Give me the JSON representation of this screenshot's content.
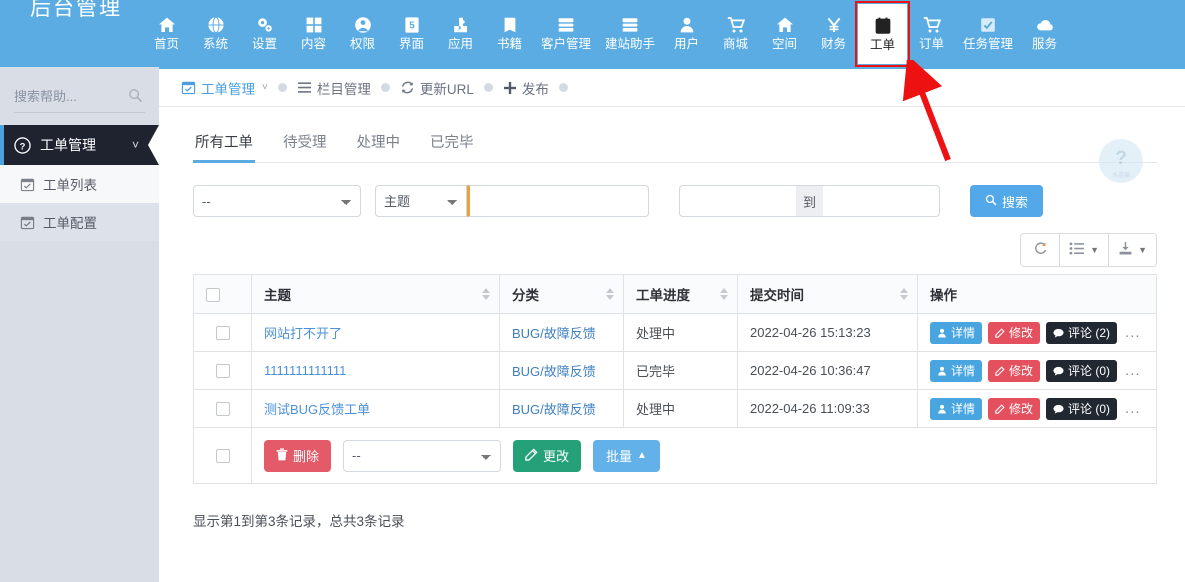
{
  "topnav": {
    "brand": "后台管理",
    "items": [
      {
        "label": "首页",
        "icon": "home-icon"
      },
      {
        "label": "系统",
        "icon": "globe-icon"
      },
      {
        "label": "设置",
        "icon": "gears-icon"
      },
      {
        "label": "内容",
        "icon": "grid-icon"
      },
      {
        "label": "权限",
        "icon": "user-circle-icon"
      },
      {
        "label": "界面",
        "icon": "layout-icon"
      },
      {
        "label": "应用",
        "icon": "puzzle-icon"
      },
      {
        "label": "书籍",
        "icon": "book-icon"
      },
      {
        "label": "客户管理",
        "icon": "server-icon"
      },
      {
        "label": "建站助手",
        "icon": "server-icon"
      },
      {
        "label": "用户",
        "icon": "user-icon"
      },
      {
        "label": "商城",
        "icon": "cart-icon"
      },
      {
        "label": "空间",
        "icon": "home-icon"
      },
      {
        "label": "财务",
        "icon": "yen-icon"
      },
      {
        "label": "工单",
        "icon": "clipboard-check-icon",
        "active": true
      },
      {
        "label": "订单",
        "icon": "cart-icon"
      },
      {
        "label": "任务管理",
        "icon": "check-square-icon"
      },
      {
        "label": "服务",
        "icon": "cloud-icon"
      }
    ]
  },
  "sidebar": {
    "search_placeholder": "搜索帮助...",
    "group": {
      "label": "工单管理",
      "icon": "question-circle-icon",
      "caret": "chevron-down-icon"
    },
    "links": [
      {
        "label": "工单列表",
        "icon": "calendar-check-icon"
      },
      {
        "label": "工单配置",
        "icon": "calendar-check-icon"
      }
    ]
  },
  "breadcrumb": [
    {
      "label": "工单管理",
      "icon": "calendar-check-icon",
      "primary": true,
      "caret": true
    },
    {
      "label": "栏目管理",
      "icon": "list-icon"
    },
    {
      "label": "更新URL",
      "icon": "refresh-icon"
    },
    {
      "label": "发布",
      "icon": "plus-icon"
    }
  ],
  "help_badge": {
    "symbol": "?",
    "caption": "水晶猫"
  },
  "tabs": [
    {
      "label": "所有工单",
      "active": true
    },
    {
      "label": "待受理",
      "active": false
    },
    {
      "label": "处理中",
      "active": false
    },
    {
      "label": "已完毕",
      "active": false
    }
  ],
  "filters": {
    "category_select": "--",
    "field_select": "主题",
    "keyword_value": "",
    "date_from": "",
    "date_to": "",
    "date_separator": "到",
    "search_button": "搜索",
    "search_icon": "search-icon"
  },
  "table_toolbar": [
    {
      "icon": "refresh-icon",
      "caret": false
    },
    {
      "icon": "columns-icon",
      "caret": true
    },
    {
      "icon": "export-icon",
      "caret": true
    }
  ],
  "table": {
    "headers": [
      "主题",
      "分类",
      "工单进度",
      "提交时间",
      "操作"
    ],
    "rows": [
      {
        "subject": "网站打不开了",
        "category": "BUG/故障反馈",
        "progress": "处理中",
        "submit_time": "2022-04-26 15:13:23",
        "actions": {
          "detail": "详情",
          "edit": "修改",
          "comment": "评论 (2)",
          "more": "..."
        }
      },
      {
        "subject": "1111111111111",
        "category": "BUG/故障反馈",
        "progress": "已完毕",
        "submit_time": "2022-04-26 10:36:47",
        "actions": {
          "detail": "详情",
          "edit": "修改",
          "comment": "评论 (0)",
          "more": "..."
        }
      },
      {
        "subject": "测试BUG反馈工单",
        "category": "BUG/故障反馈",
        "progress": "处理中",
        "submit_time": "2022-04-26 11:09:33",
        "actions": {
          "detail": "详情",
          "edit": "修改",
          "comment": "评论 (0)",
          "more": "..."
        }
      }
    ]
  },
  "bottom_bar": {
    "delete_label": "删除",
    "bulk_select": "--",
    "change_label": "更改",
    "batch_label": "批量"
  },
  "summary": "显示第1到第3条记录，总共3条记录",
  "colors": {
    "nav_blue": "#5bace3",
    "accent_blue": "#52a8e8",
    "sidebar_bg": "#d8dde6",
    "sidebar_active": "#1f2330",
    "danger_red": "#e35b68",
    "edit_red": "#e5505e",
    "success_green": "#25a179",
    "dark_btn": "#222831",
    "annotation_red": "#ee1111",
    "keyword_accent": "#e8a33d"
  }
}
